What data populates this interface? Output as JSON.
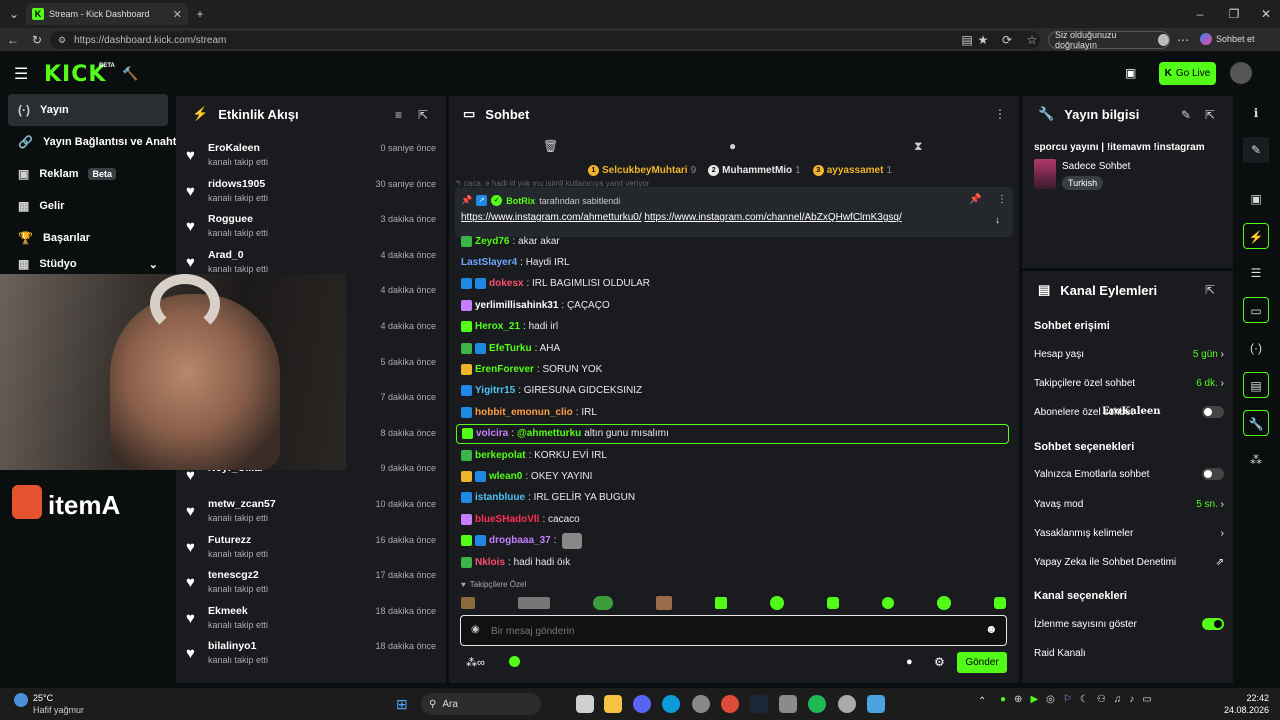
{
  "browser": {
    "tab_title": "Stream - Kick Dashboard",
    "url": "https://dashboard.kick.com/stream",
    "verify_label": "Siz olduğunuzu doğrulayın",
    "sohbet_label": "Sohbet et"
  },
  "header": {
    "logo": "KICK",
    "beta": "BETA",
    "go_live": "Go Live"
  },
  "sidebar": {
    "items": [
      {
        "label": "Yayın",
        "icon": "(·)"
      },
      {
        "label": "Yayın Bağlantısı ve Anahtarı",
        "icon": "🔗"
      },
      {
        "label": "Reklam",
        "icon": "▣",
        "badge": "Beta"
      },
      {
        "label": "Gelir",
        "icon": "▦"
      },
      {
        "label": "Başarılar",
        "icon": "🏆"
      },
      {
        "label": "Stüdyo",
        "icon": "▦"
      }
    ]
  },
  "webcam": {
    "overlay_text": "itemA"
  },
  "activity": {
    "title": "Etkinlik Akışı",
    "items": [
      {
        "name": "EroKaleen",
        "sub": "kanalı takip etti",
        "time": "0 saniye önce"
      },
      {
        "name": "ridows1905",
        "sub": "kanalı takip etti",
        "time": "30 saniye önce"
      },
      {
        "name": "Rogguee",
        "sub": "kanalı takip etti",
        "time": "3 dakika önce"
      },
      {
        "name": "Arad_0",
        "sub": "kanalı takip etti",
        "time": "4 dakika önce"
      },
      {
        "name": "",
        "sub": "",
        "time": "4 dakika önce"
      },
      {
        "name": "",
        "sub": "",
        "time": "4 dakika önce"
      },
      {
        "name": "",
        "sub": "",
        "time": "5 dakika önce"
      },
      {
        "name": "",
        "sub": "",
        "time": "7 dakika önce"
      },
      {
        "name": "",
        "sub": "",
        "time": "8 dakika önce"
      },
      {
        "name": "Noyr_Uilial",
        "sub": "",
        "time": "9 dakika önce"
      },
      {
        "name": "metw_zcan57",
        "sub": "kanalı takip etti",
        "time": "10 dakika önce"
      },
      {
        "name": "Futurezz",
        "sub": "kanalı takip etti",
        "time": "16 dakika önce"
      },
      {
        "name": "tenescgz2",
        "sub": "kanalı takip etti",
        "time": "17 dakika önce"
      },
      {
        "name": "Ekmeek",
        "sub": "kanalı takip etti",
        "time": "18 dakika önce"
      },
      {
        "name": "bilalinyo1",
        "sub": "kanalı takip etti",
        "time": "18 dakika önce"
      }
    ]
  },
  "chat": {
    "title": "Sohbet",
    "top_gifters": [
      {
        "name": "SelcukbeyMuhtari",
        "count": "9",
        "color": "#f0b429",
        "rank": "1"
      },
      {
        "name": "MuhammetMio",
        "count": "1",
        "color": "#e8e8e8",
        "rank": "2"
      },
      {
        "name": "ayyassamet",
        "count": "1",
        "color": "#f0b429",
        "rank": "3"
      }
    ],
    "faded_line": "↰ caca: e hadi irl yok mu isimli kullanıcıya yanıt veriyor",
    "pinned": {
      "author": "BotRix",
      "by_text": "tarafından sabitlendi",
      "link1": "https://www.instagram.com/ahmetturku0/",
      "link2": "https://www.instagram.com/channel/AbZxQHwfClmK3gsq/"
    },
    "messages": [
      {
        "user": "Zeyd76",
        "color": "#53fc18",
        "text": ": akar akar"
      },
      {
        "user": "LastSlayer4",
        "color": "#6ea8ff",
        "text": ": Haydi IRL"
      },
      {
        "user": "dokesx",
        "color": "#ff4d6d",
        "text": ": IRL BAGIMLISI OLDULAR"
      },
      {
        "user": "yerlimillisahink31",
        "color": "#ffffff",
        "text": ": ÇAÇAÇO"
      },
      {
        "user": "Herox_21",
        "color": "#53fc18",
        "text": ": hadi irl"
      },
      {
        "user": "EfeTurku",
        "color": "#53fc18",
        "text": ": AHA"
      },
      {
        "user": "ErenForever",
        "color": "#53fc18",
        "text": ": SORUN YOK"
      },
      {
        "user": "Yigitrr15",
        "color": "#4fc3f7",
        "text": ": GIRESUNA GIDCEKSINIZ"
      },
      {
        "user": "hobbit_emonun_clio",
        "color": "#ff9f43",
        "text": ": IRL"
      },
      {
        "user": "volcira",
        "color": "#c77dff",
        "mention": "@ahmetturku",
        "text": " altın gunu mısalımı"
      },
      {
        "user": "berkepolat",
        "color": "#53fc18",
        "text": ": KORKU EVİ IRL"
      },
      {
        "user": "wlean0",
        "color": "#53fc18",
        "text": ": OKEY YAYINI"
      },
      {
        "user": "istanbluue",
        "color": "#4fc3f7",
        "text": ": IRL GELİR YA BUGUN"
      },
      {
        "user": "blueSHadoVll",
        "color": "#ff2d55",
        "text": ": cacaco"
      },
      {
        "user": "drogbaaa_37",
        "color": "#c77dff",
        "text": ":"
      },
      {
        "user": "Nklois",
        "color": "#ff4d6d",
        "text": ": hadi hadi öık"
      }
    ],
    "emote_section": "Takipçilere Özel",
    "placeholder": "Bir mesaj gönderin",
    "send_label": "Gönder"
  },
  "stream_info": {
    "title": "Yayın bilgisi",
    "stream_title": "sporcu yayını | !itemavm !instagram",
    "category": "Sadece Sohbet",
    "tag": "Turkish"
  },
  "channel_actions": {
    "title": "Kanal Eylemleri",
    "chat_access": "Sohbet erişimi",
    "account_age": {
      "label": "Hesap yaşı",
      "value": "5 gün"
    },
    "followers_only": {
      "label": "Takipçilere özel sohbet",
      "value": "6 dk."
    },
    "subs_only": {
      "label": "Abonelere özel sohbet"
    },
    "chat_options": "Sohbet seçenekleri",
    "emotes_only": {
      "label": "Yalnızca Emotlarla sohbet"
    },
    "slow_mode": {
      "label": "Yavaş mod",
      "value": "5 sn."
    },
    "banned_words": {
      "label": "Yasaklanmış kelimeler"
    },
    "ai_moderation": {
      "label": "Yapay Zeka ile Sohbet Denetimi"
    },
    "channel_options": "Kanal seçenekleri",
    "viewer_count": {
      "label": "İzlenme sayısını göster"
    },
    "raid": {
      "label": "Raid Kanalı"
    },
    "overlay_name": "EroKaleen"
  },
  "taskbar": {
    "weather_temp": "25°C",
    "weather_desc": "Hafif yağmur",
    "search": "Ara",
    "time": "22:42",
    "date": "24.08.2026"
  }
}
